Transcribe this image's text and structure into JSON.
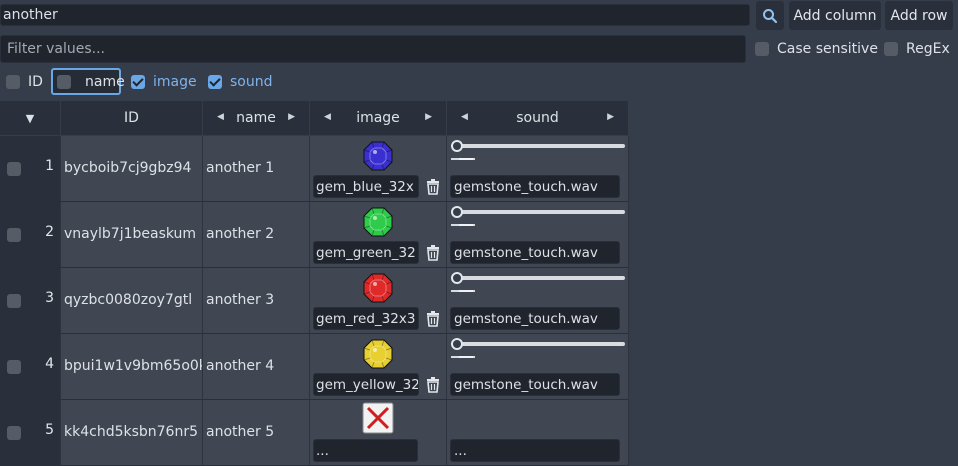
{
  "toolbar": {
    "search_value": "another",
    "add_column_label": "Add column",
    "add_row_label": "Add row",
    "filter_placeholder": "Filter values...",
    "case_sensitive_label": "Case sensitive",
    "regex_label": "RegEx"
  },
  "column_toggles": [
    {
      "label": "ID",
      "checked": false
    },
    {
      "label": "name",
      "checked": false
    },
    {
      "label": "image",
      "checked": true
    },
    {
      "label": "sound",
      "checked": true
    }
  ],
  "table": {
    "sort_glyph": "▼",
    "columns": [
      "ID",
      "name",
      "image",
      "sound"
    ],
    "rows": [
      {
        "num": "1",
        "id": "bycboib7cj9gbz94",
        "name": "another 1",
        "image": "gem_blue_32x",
        "gem_color": "#3a2fd0",
        "sound": "gemstone_touch.wav"
      },
      {
        "num": "2",
        "id": "vnaylb7j1beaskum",
        "name": "another 2",
        "image": "gem_green_32",
        "gem_color": "#2ecc4a",
        "sound": "gemstone_touch.wav"
      },
      {
        "num": "3",
        "id": "qyzbc0080zoy7gtl",
        "name": "another 3",
        "image": "gem_red_32x3",
        "gem_color": "#e02a2a",
        "sound": "gemstone_touch.wav"
      },
      {
        "num": "4",
        "id": "bpui1w1v9bm65o0k",
        "name": "another 4",
        "image": "gem_yellow_32",
        "gem_color": "#e8d030",
        "sound": "gemstone_touch.wav"
      },
      {
        "num": "5",
        "id": "kk4chd5ksbn76nr5",
        "name": "another 5",
        "image": "...",
        "gem_color": "",
        "sound": "..."
      }
    ]
  },
  "colors": {
    "accent": "#6aa7e6",
    "background": "#363d4a",
    "field": "#1f242d",
    "missing_icon": "#cc2020"
  },
  "icons": {
    "search": "search-icon",
    "trash": "trash-icon",
    "missing": "missing-image-icon"
  }
}
